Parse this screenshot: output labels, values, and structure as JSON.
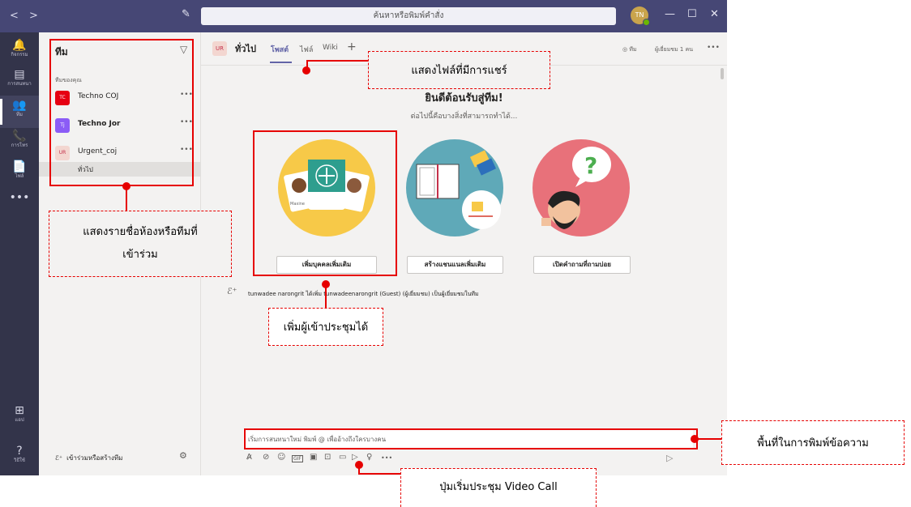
{
  "titlebar": {
    "back": "<",
    "forward": ">",
    "search_placeholder": "ค้นหาหรือพิมพ์คำสั่ง",
    "avatar_initials": "TN",
    "minimize": "—",
    "maximize": "☐",
    "close": "✕",
    "compose_icon": "✎"
  },
  "rail": [
    {
      "icon": "🔔",
      "label": "กิจกรรม"
    },
    {
      "icon": "▤",
      "label": "การสนทนา"
    },
    {
      "icon": "👥",
      "label": "ทีม"
    },
    {
      "icon": "📞",
      "label": "การโทร"
    },
    {
      "icon": "📄",
      "label": "ไฟล์"
    },
    {
      "icon": "•••",
      "label": ""
    },
    {
      "icon": "⊞",
      "label": "แอป"
    },
    {
      "icon": "?",
      "label": "วิธีใช้"
    }
  ],
  "sidebar": {
    "title": "ทีม",
    "filter_icon": "▽",
    "section": "ทีมของคุณ",
    "teams": [
      {
        "initials": "TC",
        "name": "Techno COJ",
        "color": "#e60012"
      },
      {
        "initials": "Tj",
        "name": "Techno Jor",
        "color": "#8b5cf6"
      },
      {
        "initials": "UR",
        "name": "Urgent_coj",
        "color": "#f3d6d0"
      }
    ],
    "more": "•••",
    "channel": "ทั่วไป",
    "join_label": "เข้าร่วมหรือสร้างทีม",
    "join_icon": "ℰ⁺",
    "gear": "⚙"
  },
  "channel": {
    "initials": "UR",
    "name": "ทั่วไป",
    "tabs": [
      "โพสต์",
      "ไฟล์",
      "Wiki"
    ],
    "add": "+",
    "team_label": "◎ ทีม",
    "guest_label": "ผู้เยี่ยมชม 1 คน",
    "more": "•••"
  },
  "welcome": {
    "title": "ยินดีต้อนรับสู่ทีม!",
    "subtitle": "ต่อไปนี้คือบางสิ่งที่สามารถทำได้...",
    "cards": [
      "เพิ่มบุคคลเพิ่มเติม",
      "สร้างแชนแนลเพิ่มเติม",
      "เปิดคำถามที่ถามบ่อย"
    ],
    "avatar_names": [
      "Maxine",
      ""
    ]
  },
  "activity": {
    "icon": "ℰ⁺",
    "text": "tunwadee narongrit ได้เพิ่ม tunwadeenarongrit (Guest) (ผู้เยี่ยมชม) เป็นผู้เยี่ยมชมในทีม"
  },
  "composer": {
    "placeholder": "เริ่มการสนทนาใหม่ พิมพ์ @ เพื่ออ้างถึงใครบางคน",
    "tools": [
      "A̷",
      "⊘",
      "☺",
      "GIF",
      "▣",
      "⊡",
      "▭",
      "▷",
      "♀",
      "•••"
    ],
    "send": "▷"
  },
  "annotations": {
    "files": "แสดงไฟล์ที่มีการแชร์",
    "teams_list_1": "แสดงรายชื่อห้องหรือทีมที่",
    "teams_list_2": "เข้าร่วม",
    "add_people": "เพิ่มผู้เข้าประชุมได้",
    "compose": "พื้นที่ในการพิมพ์ข้อความ",
    "video": "ปุ่มเริ่มประชุม Video Call"
  }
}
